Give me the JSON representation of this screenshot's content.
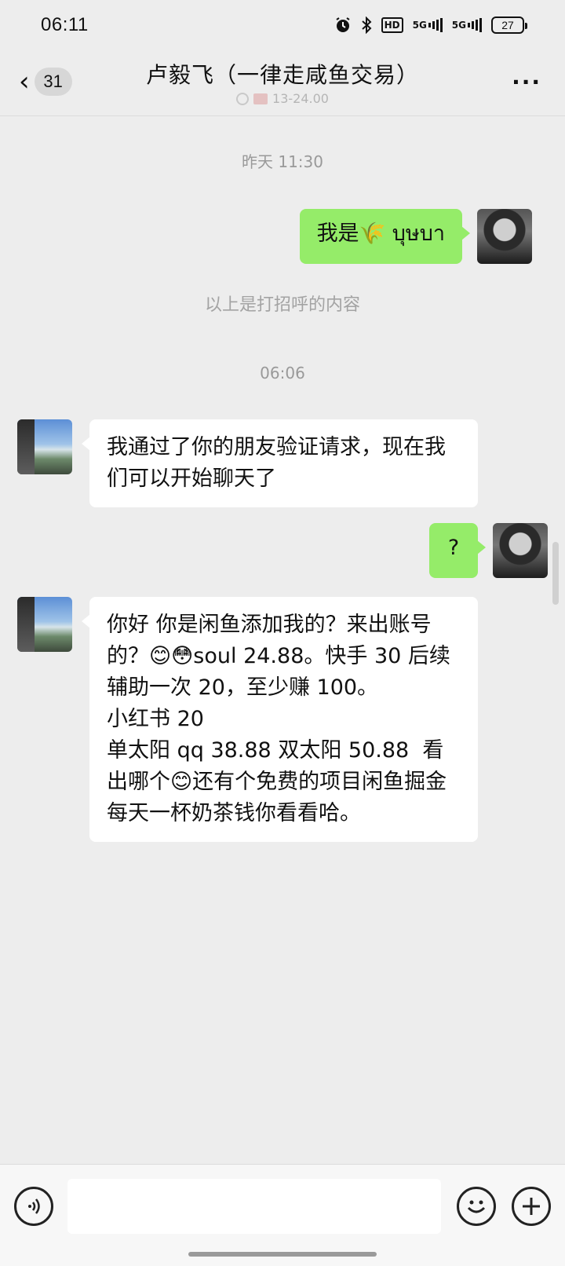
{
  "status_bar": {
    "time": "06:11",
    "hd_label": "HD",
    "network_1": "5G",
    "network_2": "5G",
    "battery": "27",
    "icons": [
      "alarm-icon",
      "bluetooth-icon",
      "hd-voice-icon",
      "signal-icon",
      "signal-icon",
      "battery-icon"
    ]
  },
  "header": {
    "unread_count": "31",
    "title": "卢毅飞（一律走咸鱼交易）",
    "subtitle": "13-24.00",
    "more_label": "···",
    "back_icon": "chevron-left-icon"
  },
  "chat": {
    "timestamp_1": "昨天 11:30",
    "msg_me_1": "我是🌾 บุษบา",
    "greeting_note": "以上是打招呼的内容",
    "timestamp_2": "06:06",
    "msg_them_1": "我通过了你的朋友验证请求，现在我们可以开始聊天了",
    "msg_me_2": "?",
    "msg_them_2": "你好 你是闲鱼添加我的？来出账号的？😊😳soul 24.88。快手 30 后续辅助一次 20，至少赚 100。\n小红书 20\n单太阳 qq 38.88 双太阳 50.88  看出哪个😊还有个免费的项目闲鱼掘金每天一杯奶茶钱你看看哈。"
  },
  "input_bar": {
    "voice_icon": "voice-icon",
    "emoji_icon": "emoji-icon",
    "plus_icon": "plus-icon",
    "text_value": ""
  },
  "colors": {
    "background": "#ededed",
    "my_bubble": "#95ec69",
    "their_bubble": "#ffffff"
  }
}
